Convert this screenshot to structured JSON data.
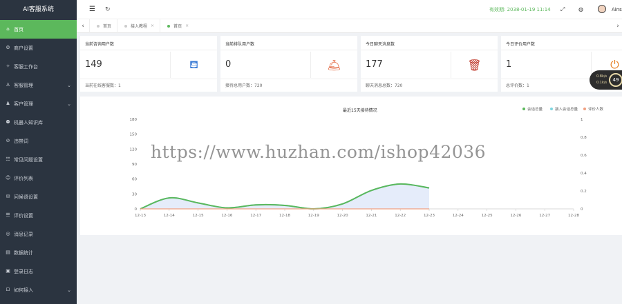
{
  "app": {
    "title": "AI客服系统"
  },
  "sidebar": {
    "items": [
      {
        "label": "首页",
        "icon": "home-icon",
        "active": true,
        "expandable": false
      },
      {
        "label": "商户设置",
        "icon": "gear-icon",
        "active": false,
        "expandable": false
      },
      {
        "label": "客服工作台",
        "icon": "workbench-icon",
        "active": false,
        "expandable": false
      },
      {
        "label": "客服管理",
        "icon": "user-icon",
        "active": false,
        "expandable": true
      },
      {
        "label": "客户管理",
        "icon": "users-icon",
        "active": false,
        "expandable": true
      },
      {
        "label": "机器人知识库",
        "icon": "robot-icon",
        "active": false,
        "expandable": false
      },
      {
        "label": "违禁词",
        "icon": "ban-icon",
        "active": false,
        "expandable": false
      },
      {
        "label": "常见问题设置",
        "icon": "faq-icon",
        "active": false,
        "expandable": false
      },
      {
        "label": "评价列表",
        "icon": "rating-icon",
        "active": false,
        "expandable": false
      },
      {
        "label": "问候语设置",
        "icon": "greeting-icon",
        "active": false,
        "expandable": false
      },
      {
        "label": "评价设置",
        "icon": "rating-settings-icon",
        "active": false,
        "expandable": false
      },
      {
        "label": "消息记录",
        "icon": "message-icon",
        "active": false,
        "expandable": false
      },
      {
        "label": "数据统计",
        "icon": "stats-icon",
        "active": false,
        "expandable": false
      },
      {
        "label": "登录日志",
        "icon": "log-icon",
        "active": false,
        "expandable": false
      },
      {
        "label": "如何接入",
        "icon": "integrate-icon",
        "active": false,
        "expandable": true
      }
    ]
  },
  "header": {
    "expire_label": "有效期:",
    "expire_value": "2038-01-19 11:14",
    "username": "Ainsl"
  },
  "tabs": [
    {
      "label": "首页",
      "closable": false,
      "active": false
    },
    {
      "label": "接入教程",
      "closable": true,
      "active": false
    },
    {
      "label": "首页",
      "closable": true,
      "active": true
    }
  ],
  "cards": [
    {
      "title": "当前咨询用户数",
      "value": "149",
      "footer": "当前在线客服数：1",
      "icon": "cup-icon",
      "icon_color": "#3a7bd5"
    },
    {
      "title": "当前排队用户数",
      "value": "0",
      "footer": "接待总用户数：720",
      "icon": "bell-queue-icon",
      "icon_color": "#e0572b"
    },
    {
      "title": "今日聊天消息数",
      "value": "177",
      "footer": "聊天消息总数：720",
      "icon": "trash-icon",
      "icon_color": "#c0392b"
    },
    {
      "title": "今日评价用户数",
      "value": "1",
      "footer": "总评价数：1",
      "icon": "plug-icon",
      "icon_color": "#e67e22"
    }
  ],
  "float_widget": {
    "line1": "0.8k/s",
    "line2": "0.1k/s",
    "percent": "49"
  },
  "watermark": "https://www.huzhan.com/ishop42036",
  "chart_data": {
    "type": "area",
    "title": "最近15天接待情况",
    "categories": [
      "12-13",
      "12-14",
      "12-15",
      "12-16",
      "12-17",
      "12-18",
      "12-19",
      "12-20",
      "12-21",
      "12-22",
      "12-23",
      "12-24",
      "12-25",
      "12-26",
      "12-27",
      "12-28"
    ],
    "ylim": [
      0,
      180
    ],
    "y_ticks": [
      0,
      30,
      60,
      90,
      120,
      150,
      180
    ],
    "y2lim": [
      0,
      1
    ],
    "y2_ticks": [
      0,
      0.2,
      0.4,
      0.6,
      0.8,
      1
    ],
    "legend_position": "top-right",
    "series": [
      {
        "name": "会话总量",
        "color": "#5cb85c",
        "values": [
          0,
          22,
          12,
          2,
          8,
          7,
          0,
          10,
          37,
          50,
          42,
          null,
          null,
          null,
          null,
          null
        ]
      },
      {
        "name": "接入会话总量",
        "color": "#7fd6e0",
        "values": [
          0,
          22,
          12,
          2,
          8,
          7,
          0,
          10,
          37,
          50,
          42,
          null,
          null,
          null,
          null,
          null
        ]
      },
      {
        "name": "评价人数",
        "color": "#f0a080",
        "values": [
          0,
          0,
          0,
          0,
          0,
          0,
          0,
          0,
          0,
          0,
          0,
          null,
          null,
          null,
          null,
          null
        ]
      }
    ]
  }
}
